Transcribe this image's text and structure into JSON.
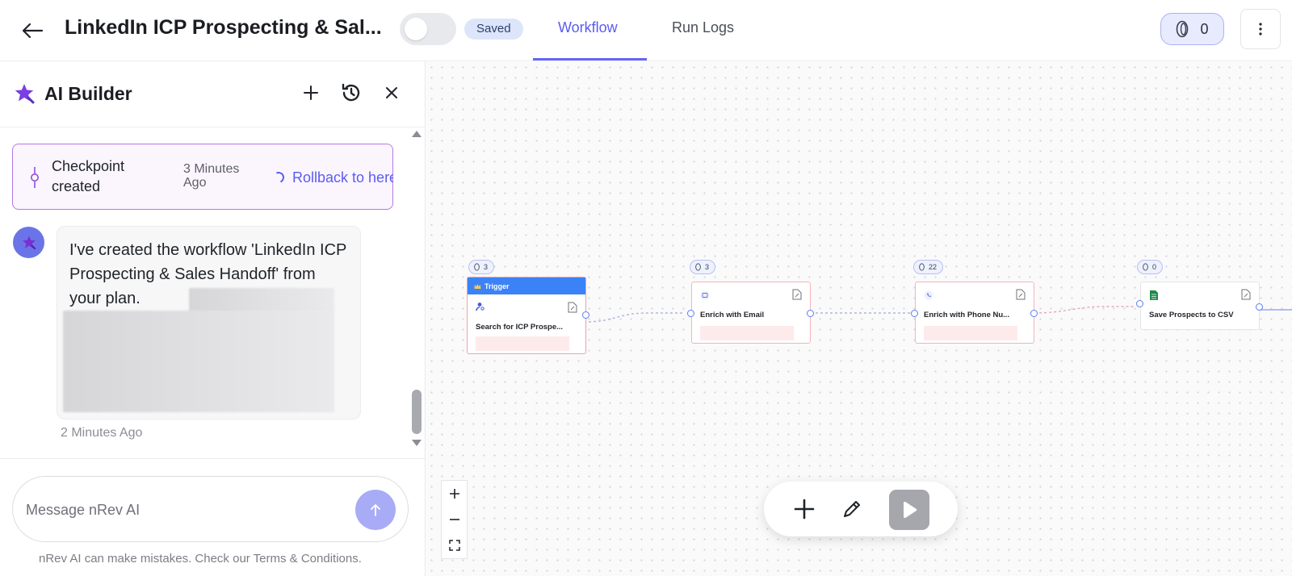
{
  "header": {
    "title": "LinkedIn ICP Prospecting & Sal...",
    "saved_badge": "Saved",
    "tabs": [
      {
        "label": "Workflow",
        "active": true
      },
      {
        "label": "Run Logs",
        "active": false
      }
    ],
    "credits": "0"
  },
  "sidebar": {
    "title": "AI Builder",
    "checkpoint": {
      "label": "Checkpoint created",
      "time": "3 Minutes Ago",
      "action": "Rollback to here"
    },
    "messages": [
      {
        "text": "I've created the workflow 'LinkedIn ICP Prospecting & Sales Handoff' from your plan.",
        "time": "2 Minutes Ago"
      }
    ],
    "composer": {
      "placeholder": "Message nRev AI"
    },
    "disclaimer": "nRev AI can make mistakes. Check our Terms & Conditions."
  },
  "workflow": {
    "nodes": [
      {
        "label": "Search for ICP Prospe...",
        "credits": "3",
        "trigger_label": "Trigger",
        "icon": "user-search-icon"
      },
      {
        "label": "Enrich with Email",
        "credits": "3",
        "icon": "calendar-icon"
      },
      {
        "label": "Enrich with Phone Nu...",
        "credits": "22",
        "icon": "phone-icon"
      },
      {
        "label": "Save Prospects to CSV",
        "credits": "0",
        "icon": "spreadsheet-icon"
      }
    ]
  },
  "colors": {
    "accent": "#6366f1",
    "trigger": "#3b82f6",
    "error_border": "#f4b4bb",
    "checkpoint_border": "#b57ae6"
  }
}
